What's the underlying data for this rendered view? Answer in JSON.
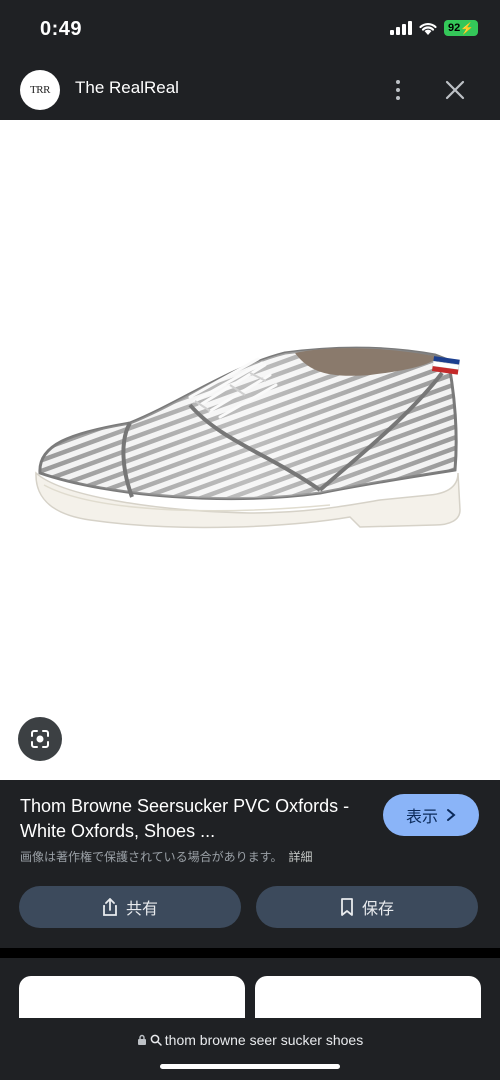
{
  "status": {
    "time": "0:49",
    "battery": "92"
  },
  "header": {
    "logo_text": "TRR",
    "site_name": "The RealReal"
  },
  "product": {
    "title": "Thom Browne Seersucker PVC Oxfords - White Oxfords, Shoes ...",
    "view_label": "表示",
    "copyright": "画像は著作権で保護されている場合があります。",
    "details_label": "詳細",
    "share_label": "共有",
    "save_label": "保存"
  },
  "url_bar": {
    "query": "thom browne seer sucker shoes"
  },
  "colors": {
    "accent": "#8ab4f8",
    "background": "#1f2124",
    "button": "#3c4a5c",
    "battery": "#34c759"
  },
  "icons": [
    "signal-icon",
    "wifi-icon",
    "more-vert-icon",
    "close-icon",
    "lens-icon",
    "chevron-right-icon",
    "share-icon",
    "bookmark-icon",
    "lock-icon",
    "search-icon"
  ]
}
